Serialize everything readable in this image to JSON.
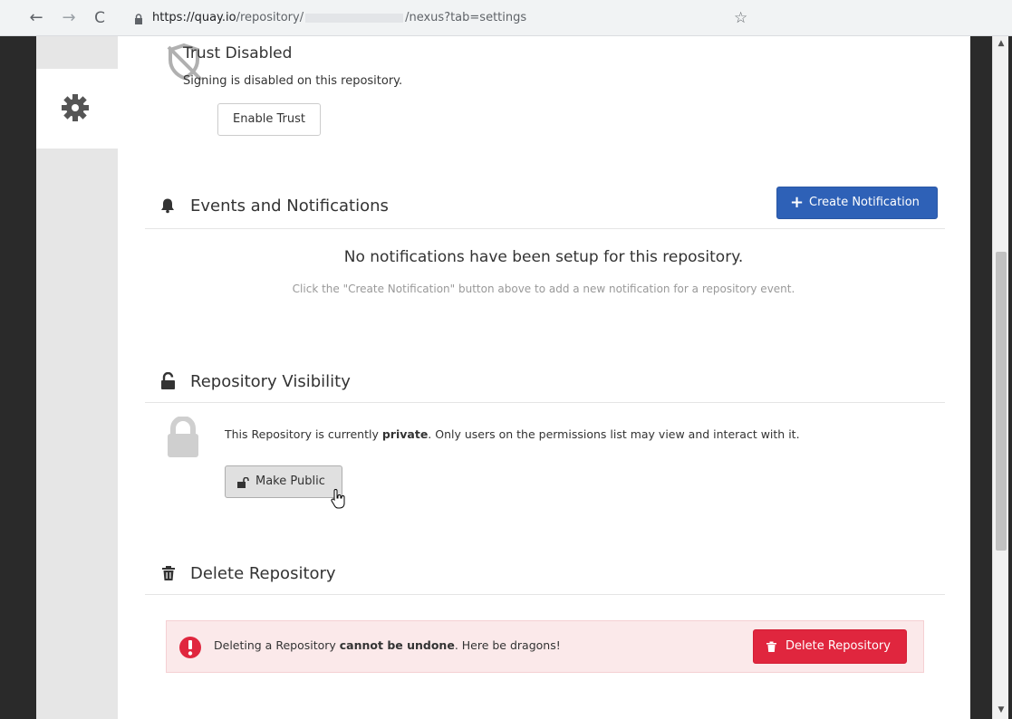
{
  "browser": {
    "url_prefix": "https://quay.io",
    "url_path": "/repository/",
    "url_suffix": "/nexus?tab=settings"
  },
  "trust": {
    "title": "Trust Disabled",
    "description": "Signing is disabled on this repository.",
    "enable_button": "Enable Trust"
  },
  "notifications": {
    "title": "Events and Notifications",
    "create_button": "Create Notification",
    "empty_title": "No notifications have been setup for this repository.",
    "empty_hint": "Click the \"Create Notification\" button above to add a new notification for a repository event."
  },
  "visibility": {
    "title": "Repository Visibility",
    "text_before": "This Repository is currently ",
    "status": "private",
    "text_after": ". Only users on the permissions list may view and interact with it.",
    "make_public_button": "Make Public"
  },
  "delete": {
    "title": "Delete Repository",
    "warning_before": "Deleting a Repository ",
    "warning_bold": "cannot be undone",
    "warning_after": ". Here be dragons!",
    "delete_button": "Delete Repository"
  },
  "colors": {
    "primary": "#2e61b7",
    "danger": "#e0263e",
    "danger_bg": "#fbe9ea"
  },
  "icons": [
    "back-arrow-icon",
    "forward-arrow-icon",
    "reload-icon",
    "lock-icon",
    "star-icon",
    "gear-icon",
    "shield-slash-icon",
    "bell-icon",
    "plus-icon",
    "unlock-icon",
    "padlock-icon",
    "trash-icon",
    "exclamation-icon"
  ]
}
